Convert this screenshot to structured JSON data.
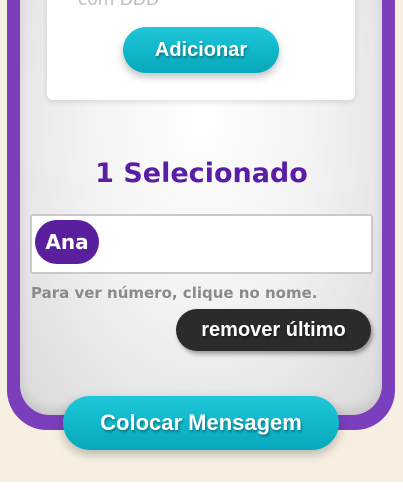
{
  "phone_input": {
    "placeholder": "com DDD"
  },
  "actions": {
    "add_label": "Adicionar",
    "remove_last_label": "remover último",
    "compose_label": "Colocar Mensagem"
  },
  "selection": {
    "count_text": "1 Selecionado",
    "contacts": [
      {
        "name": "Ana"
      }
    ],
    "hint": "Para ver número, clique no nome."
  },
  "colors": {
    "frame": "#7b3fbe",
    "accent": "#06a8bb",
    "chip": "#5a1f9c",
    "title": "#5a1ea6",
    "dark_button": "#2b2b2b"
  }
}
